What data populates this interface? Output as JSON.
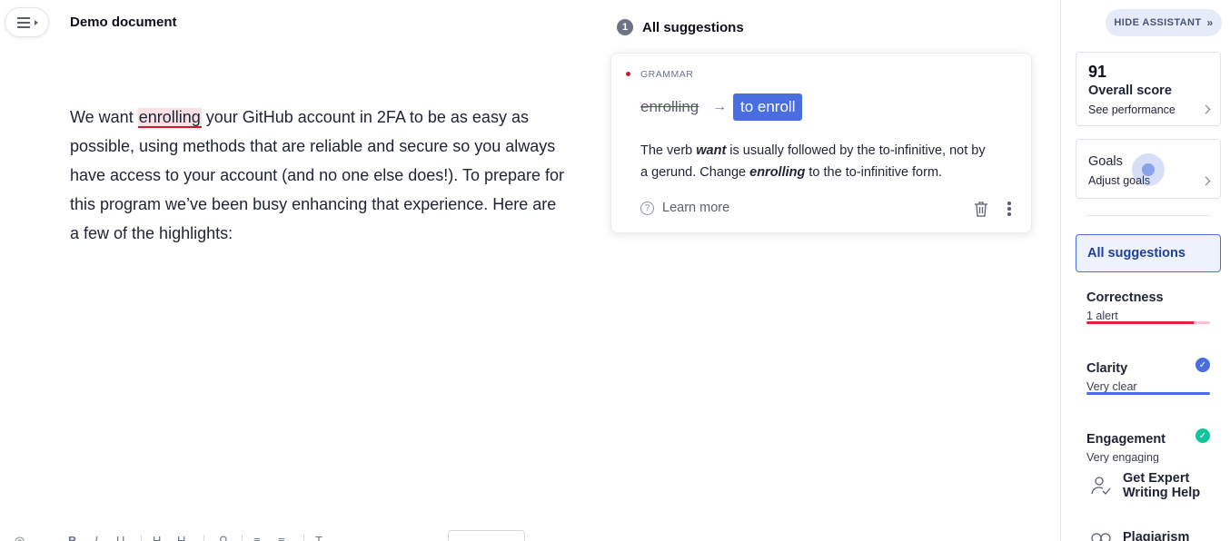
{
  "document": {
    "title": "Demo document",
    "text_before": "We want ",
    "highlighted_word": "enrolling",
    "text_after": " your GitHub account in 2FA to be as easy as possible, using methods that are reliable and secure so you always have access to your account (and no one else does!). To prepare for this program we’ve been busy enhancing that experience. Here are a few of the highlights:"
  },
  "suggestions": {
    "count": "1",
    "title": "All suggestions",
    "card": {
      "category": "GRAMMAR",
      "original": "enrolling",
      "replacement": "to enroll",
      "explanation_1": "The verb ",
      "explanation_verb": "want",
      "explanation_2": " is usually followed by the to-infinitive, not by a gerund. Change ",
      "explanation_word": "enrolling",
      "explanation_3": " to the to-infinitive form.",
      "learn_more": "Learn more",
      "icons": {
        "help": "help-circle-icon",
        "delete": "trash-icon",
        "more": "more-vertical-icon"
      },
      "colors": {
        "alert": "#d4182f",
        "accent": "#4a6ee0"
      }
    }
  },
  "assistant": {
    "hide_label": "HIDE ASSISTANT",
    "score": {
      "value": "91",
      "label": "Overall score",
      "link": "See performance"
    },
    "goals": {
      "label": "Goals",
      "link": "Adjust goals"
    },
    "all_suggestions_label": "All suggestions",
    "metrics": [
      {
        "name": "Correctness",
        "sub": "1 alert",
        "color": "#e0243d",
        "fill": 0.87
      },
      {
        "name": "Clarity",
        "sub": "Very clear",
        "color": "#4a6ee0",
        "fill": 1.0
      },
      {
        "name": "Engagement",
        "sub": "Very engaging",
        "color": "#15c39a",
        "fill": 1.0
      }
    ],
    "expert_line1": "Get Expert",
    "expert_line2": "Writing Help",
    "plagiarism": "Plagiarism"
  }
}
